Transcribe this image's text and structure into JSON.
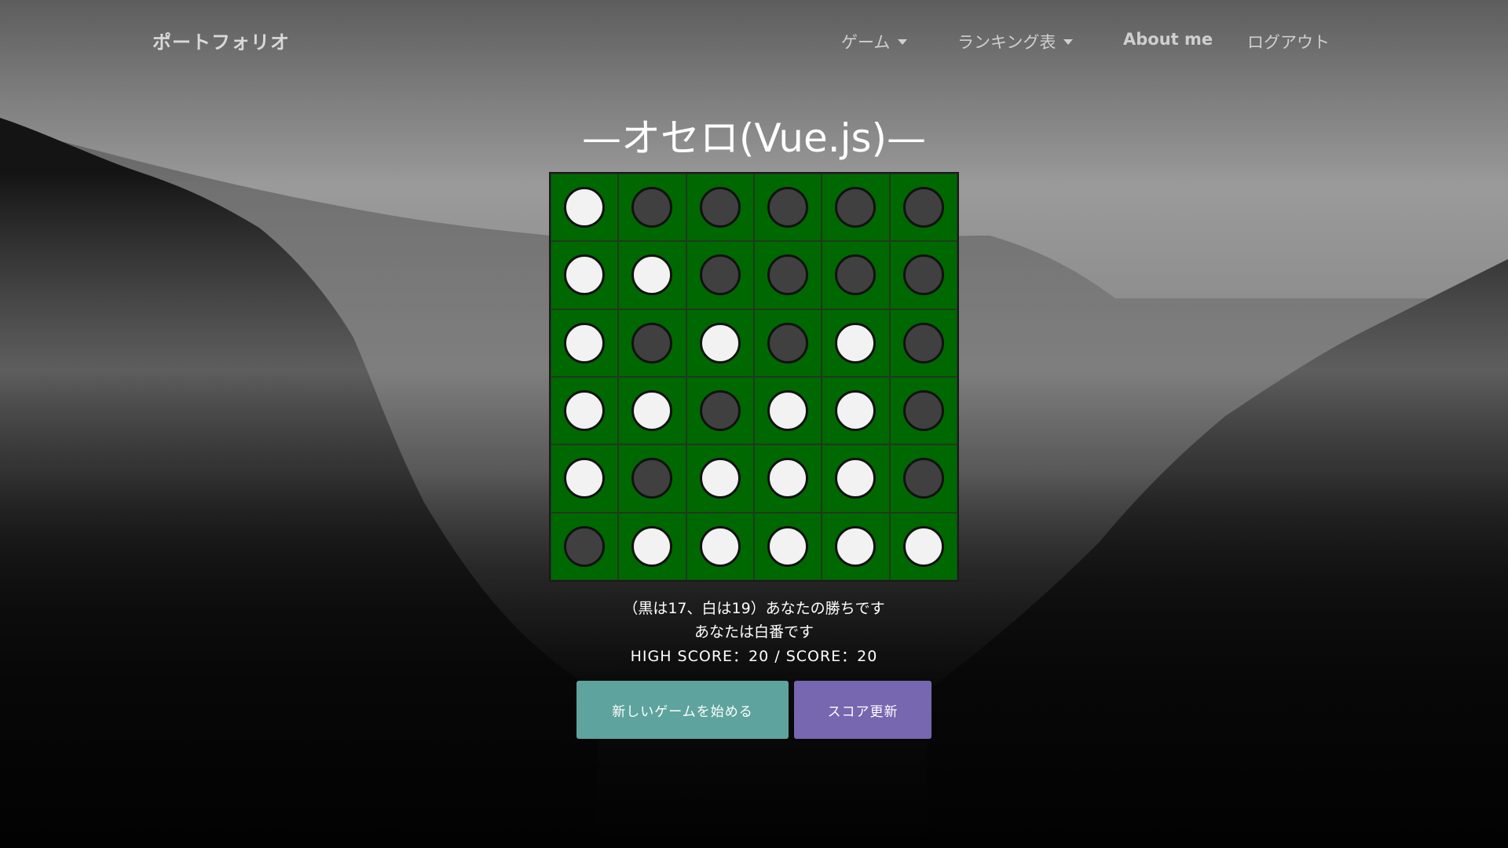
{
  "navbar": {
    "brand": "ポートフォリオ",
    "items": [
      {
        "label": "ゲーム",
        "dropdown": true
      },
      {
        "label": "ランキング表",
        "dropdown": true
      },
      {
        "label": "About me",
        "dropdown": false
      },
      {
        "label": "ログアウト",
        "dropdown": false
      }
    ]
  },
  "game": {
    "title": "—オセロ(Vue.js)—",
    "board": [
      [
        "white",
        "black",
        "black",
        "black",
        "black",
        "black"
      ],
      [
        "white",
        "white",
        "black",
        "black",
        "black",
        "black"
      ],
      [
        "white",
        "black",
        "white",
        "black",
        "white",
        "black"
      ],
      [
        "white",
        "white",
        "black",
        "white",
        "white",
        "black"
      ],
      [
        "white",
        "black",
        "white",
        "white",
        "white",
        "black"
      ],
      [
        "black",
        "white",
        "white",
        "white",
        "white",
        "white"
      ]
    ],
    "result_text": "（黒は17、白は19）あなたの勝ちです",
    "turn_text": "あなたは白番です",
    "score_text": "HIGH SCORE：20 / SCORE：20",
    "new_game_label": "新しいゲームを始める",
    "update_score_label": "スコア更新"
  },
  "colors": {
    "board": "#006800",
    "new_game_button": "#5ea39d",
    "update_score_button": "#7766b0"
  }
}
